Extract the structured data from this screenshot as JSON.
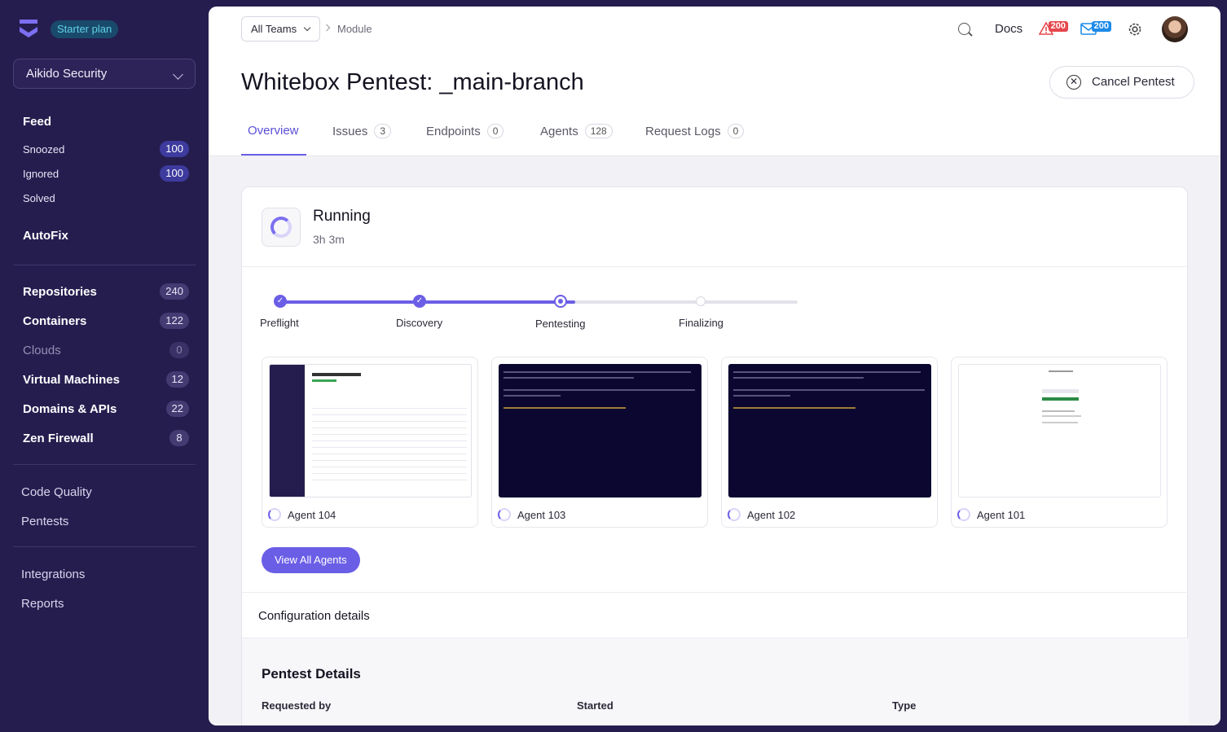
{
  "sidebar": {
    "plan": "Starter plan",
    "org": "Aikido Security",
    "feed": {
      "label": "Feed",
      "items": [
        {
          "label": "Snoozed",
          "count": "100"
        },
        {
          "label": "Ignored",
          "count": "100"
        },
        {
          "label": "Solved"
        }
      ]
    },
    "autofix": "AutoFix",
    "assets": [
      {
        "label": "Repositories",
        "count": "240"
      },
      {
        "label": "Containers",
        "count": "122"
      },
      {
        "label": "Clouds",
        "count": "0"
      },
      {
        "label": "Virtual Machines",
        "count": "12"
      },
      {
        "label": "Domains & APIs",
        "count": "22"
      },
      {
        "label": "Zen Firewall",
        "count": "8"
      }
    ],
    "tools": [
      "Code Quality",
      "Pentests"
    ],
    "other": [
      "Integrations",
      "Reports"
    ]
  },
  "header": {
    "teams": "All Teams",
    "crumb": "Module",
    "docs": "Docs",
    "alerts_count": "200",
    "mail_count": "200",
    "colors": {
      "alert": "#e5484d",
      "mail": "#1d8ae8"
    }
  },
  "page": {
    "title": "Whitebox Pentest: _main-branch",
    "cancel": "Cancel Pentest",
    "tabs": [
      {
        "label": "Overview"
      },
      {
        "label": "Issues",
        "count": "3"
      },
      {
        "label": "Endpoints",
        "count": "0"
      },
      {
        "label": "Agents",
        "count": "128"
      },
      {
        "label": "Request Logs",
        "count": "0"
      }
    ]
  },
  "status": {
    "title": "Running",
    "elapsed": "3h 3m"
  },
  "progress": {
    "steps": [
      "Preflight",
      "Discovery",
      "Pentesting",
      "Finalizing"
    ],
    "fraction_complete": 0.57
  },
  "agents": [
    {
      "name": "Agent 104"
    },
    {
      "name": "Agent 103"
    },
    {
      "name": "Agent 102"
    },
    {
      "name": "Agent 101"
    }
  ],
  "view_all": "View All Agents",
  "config": {
    "label": "Configuration details",
    "details_title": "Pentest Details",
    "columns": [
      "Requested by",
      "Started",
      "Type"
    ]
  },
  "theme": {
    "accent": "#6b5ee6",
    "sidebar": "#261d4f"
  }
}
